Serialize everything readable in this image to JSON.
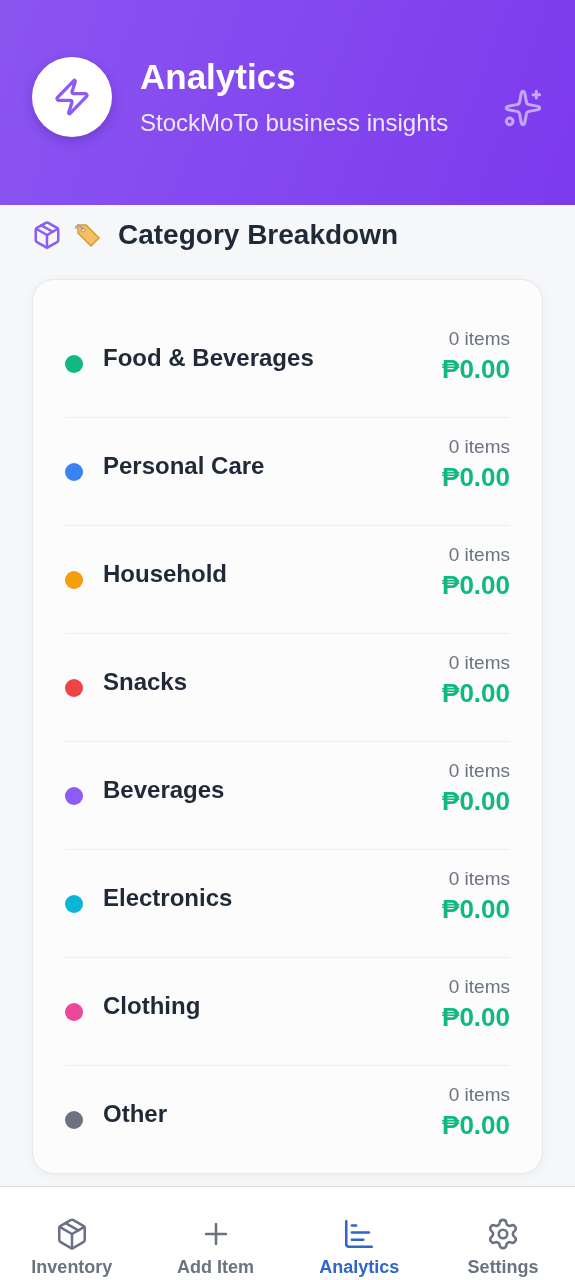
{
  "header": {
    "title": "Analytics",
    "subtitle": "StockMoTo business insights"
  },
  "section": {
    "title": "Category Breakdown"
  },
  "categories": [
    {
      "name": "Food & Beverages",
      "color": "#10b981",
      "count": "0 items",
      "value": "₱0.00"
    },
    {
      "name": "Personal Care",
      "color": "#3b82f6",
      "count": "0 items",
      "value": "₱0.00"
    },
    {
      "name": "Household",
      "color": "#f59e0b",
      "count": "0 items",
      "value": "₱0.00"
    },
    {
      "name": "Snacks",
      "color": "#ef4444",
      "count": "0 items",
      "value": "₱0.00"
    },
    {
      "name": "Beverages",
      "color": "#8b5cf6",
      "count": "0 items",
      "value": "₱0.00"
    },
    {
      "name": "Electronics",
      "color": "#06b6d4",
      "count": "0 items",
      "value": "₱0.00"
    },
    {
      "name": "Clothing",
      "color": "#ec4899",
      "count": "0 items",
      "value": "₱0.00"
    },
    {
      "name": "Other",
      "color": "#6b7280",
      "count": "0 items",
      "value": "₱0.00"
    }
  ],
  "nav": [
    {
      "kind": "inventory",
      "label": "Inventory",
      "selected": false
    },
    {
      "kind": "add",
      "label": "Add Item",
      "selected": false
    },
    {
      "kind": "analytics",
      "label": "Analytics",
      "selected": true
    },
    {
      "kind": "settings",
      "label": "Settings",
      "selected": false
    }
  ]
}
